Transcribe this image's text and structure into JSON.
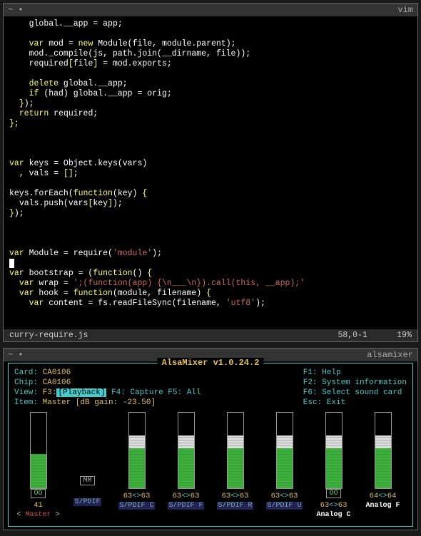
{
  "vim": {
    "prompt": "~ •",
    "title": "vim",
    "status": {
      "file": "curry-require.js",
      "pos": "58,0-1",
      "pct": "19%"
    },
    "code": [
      {
        "indent": 2,
        "tokens": [
          {
            "t": "global",
            "c": "id"
          },
          {
            "t": ".",
            "c": "op"
          },
          {
            "t": "__app",
            "c": "id"
          },
          {
            "t": " = app;",
            "c": "op"
          }
        ]
      },
      {
        "indent": 0,
        "tokens": []
      },
      {
        "indent": 2,
        "tokens": [
          {
            "t": "var",
            "c": "kw"
          },
          {
            "t": " mod = ",
            "c": "op"
          },
          {
            "t": "new",
            "c": "kw"
          },
          {
            "t": " Module(file, module.parent);",
            "c": "op"
          }
        ]
      },
      {
        "indent": 2,
        "tokens": [
          {
            "t": "mod._compile(js, path.join(__dirname, file));",
            "c": "op"
          }
        ]
      },
      {
        "indent": 2,
        "tokens": [
          {
            "t": "required",
            "c": "id"
          },
          {
            "t": "[",
            "c": "kw"
          },
          {
            "t": "file",
            "c": "id"
          },
          {
            "t": "]",
            "c": "kw"
          },
          {
            "t": " = mod.exports;",
            "c": "op"
          }
        ]
      },
      {
        "indent": 0,
        "tokens": []
      },
      {
        "indent": 2,
        "tokens": [
          {
            "t": "delete",
            "c": "kw"
          },
          {
            "t": " global.__app;",
            "c": "op"
          }
        ]
      },
      {
        "indent": 2,
        "tokens": [
          {
            "t": "if",
            "c": "kw"
          },
          {
            "t": " (had) global.__app = orig;",
            "c": "op"
          }
        ]
      },
      {
        "indent": 1,
        "tokens": [
          {
            "t": "}",
            "c": "kw"
          },
          {
            "t": ");",
            "c": "op"
          }
        ]
      },
      {
        "indent": 1,
        "tokens": [
          {
            "t": "return",
            "c": "kw"
          },
          {
            "t": " required;",
            "c": "op"
          }
        ]
      },
      {
        "indent": 0,
        "tokens": [
          {
            "t": "};",
            "c": "kw"
          }
        ]
      },
      {
        "indent": 0,
        "tokens": []
      },
      {
        "indent": 0,
        "tokens": []
      },
      {
        "indent": 0,
        "tokens": []
      },
      {
        "indent": 0,
        "tokens": [
          {
            "t": "var",
            "c": "kw"
          },
          {
            "t": " keys = Object.keys(vars)",
            "c": "op"
          }
        ]
      },
      {
        "indent": 1,
        "tokens": [
          {
            "t": ", vals = ",
            "c": "op"
          },
          {
            "t": "[]",
            "c": "kw"
          },
          {
            "t": ";",
            "c": "op"
          }
        ]
      },
      {
        "indent": 0,
        "tokens": []
      },
      {
        "indent": 0,
        "tokens": [
          {
            "t": "keys.forEach(",
            "c": "op"
          },
          {
            "t": "function",
            "c": "kw"
          },
          {
            "t": "(key) ",
            "c": "op"
          },
          {
            "t": "{",
            "c": "kw"
          }
        ]
      },
      {
        "indent": 1,
        "tokens": [
          {
            "t": "vals.push(vars",
            "c": "op"
          },
          {
            "t": "[",
            "c": "kw"
          },
          {
            "t": "key",
            "c": "id"
          },
          {
            "t": "]",
            "c": "kw"
          },
          {
            "t": ");",
            "c": "op"
          }
        ]
      },
      {
        "indent": 0,
        "tokens": [
          {
            "t": "}",
            "c": "kw"
          },
          {
            "t": ");",
            "c": "op"
          }
        ]
      },
      {
        "indent": 0,
        "tokens": []
      },
      {
        "indent": 0,
        "tokens": []
      },
      {
        "indent": 0,
        "tokens": []
      },
      {
        "indent": 0,
        "tokens": [
          {
            "t": "var",
            "c": "kw"
          },
          {
            "t": " Module = require(",
            "c": "op"
          },
          {
            "t": "'module'",
            "c": "str"
          },
          {
            "t": ");",
            "c": "op"
          }
        ]
      },
      {
        "indent": 0,
        "tokens": [
          {
            "t": " ",
            "c": "cursor"
          }
        ]
      },
      {
        "indent": 0,
        "tokens": [
          {
            "t": "var",
            "c": "kw"
          },
          {
            "t": " bootstrap = (",
            "c": "op"
          },
          {
            "t": "function",
            "c": "kw"
          },
          {
            "t": "() ",
            "c": "op"
          },
          {
            "t": "{",
            "c": "kw"
          }
        ]
      },
      {
        "indent": 1,
        "tokens": [
          {
            "t": "var",
            "c": "kw"
          },
          {
            "t": " wrap = ",
            "c": "op"
          },
          {
            "t": "';(function(app) {\\n___\\n}).call(this, __app);'",
            "c": "str"
          }
        ]
      },
      {
        "indent": 1,
        "tokens": [
          {
            "t": "var",
            "c": "kw"
          },
          {
            "t": " hook = ",
            "c": "op"
          },
          {
            "t": "function",
            "c": "kw"
          },
          {
            "t": "(module, filename) ",
            "c": "op"
          },
          {
            "t": "{",
            "c": "kw"
          }
        ]
      },
      {
        "indent": 2,
        "tokens": [
          {
            "t": "var",
            "c": "kw"
          },
          {
            "t": " content = fs.readFileSync(filename, ",
            "c": "op"
          },
          {
            "t": "'utf8'",
            "c": "str"
          },
          {
            "t": ");",
            "c": "op"
          }
        ]
      }
    ]
  },
  "alsa": {
    "prompt": "~ •",
    "title": "alsamixer",
    "app_title": "AlsaMixer v1.0.24.2",
    "left": {
      "card_label": "Card:",
      "card": "CA0106",
      "chip_label": "Chip:",
      "chip": "CA0106",
      "view_label": "View:",
      "f3": "F3:",
      "playback": "[Playback]",
      "f4": "F4: Capture",
      "f5": "F5: All",
      "item_label": "Item:",
      "item": "Master [dB gain: -23.50]"
    },
    "right": {
      "f1": "F1:",
      "f1v": "Help",
      "f2": "F2:",
      "f2v": "System information",
      "f6": "F6:",
      "f6v": "Select sound card",
      "esc": "Esc:",
      "escv": "Exit"
    },
    "channels": [
      {
        "name": "Master",
        "style": "master",
        "level_l": "41",
        "level_r": "",
        "green": 48,
        "white": 0,
        "box": "OO",
        "mm": false
      },
      {
        "name": "S/PDIF",
        "style": "blue",
        "level_l": "",
        "level_r": "",
        "green": 0,
        "white": 0,
        "box": "MM",
        "mm": true
      },
      {
        "name": "S/PDIF C",
        "style": "blue",
        "level_l": "63",
        "level_r": "63",
        "green": 56,
        "white": 18,
        "box": "",
        "mm": false
      },
      {
        "name": "S/PDIF F",
        "style": "blue",
        "level_l": "63",
        "level_r": "63",
        "green": 56,
        "white": 18,
        "box": "",
        "mm": false
      },
      {
        "name": "S/PDIF R",
        "style": "blue",
        "level_l": "63",
        "level_r": "63",
        "green": 56,
        "white": 18,
        "box": "",
        "mm": false
      },
      {
        "name": "S/PDIF U",
        "style": "blue",
        "level_l": "63",
        "level_r": "63",
        "green": 56,
        "white": 18,
        "box": "",
        "mm": false
      },
      {
        "name": "Analog C",
        "style": "white",
        "level_l": "63",
        "level_r": "63",
        "green": 56,
        "white": 18,
        "box": "OO",
        "mm": false
      },
      {
        "name": "Analog F",
        "style": "white",
        "level_l": "64",
        "level_r": "64",
        "green": 56,
        "white": 18,
        "box": "",
        "mm": false
      }
    ]
  }
}
